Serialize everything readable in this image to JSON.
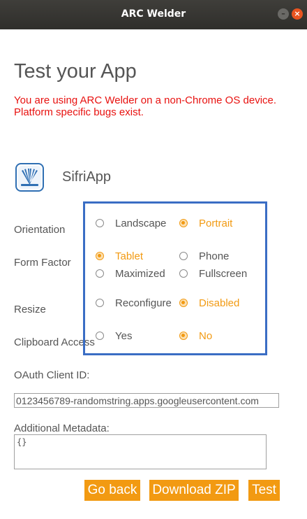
{
  "window": {
    "title": "ARC Welder",
    "minimize_glyph": "–",
    "close_glyph": "×"
  },
  "page": {
    "title": "Test your App",
    "warning": "You are using ARC Welder on a non-Chrome OS device. Platform specific bugs exist."
  },
  "app": {
    "name": "SifriApp",
    "icon": "books-icon"
  },
  "labels": {
    "orientation": "Orientation",
    "form_factor": "Form Factor",
    "resize": "Resize",
    "clipboard_access": "Clipboard Access",
    "oauth_client_id": "OAuth Client ID:",
    "additional_metadata": "Additional Metadata:"
  },
  "options": {
    "orientation": [
      {
        "label": "Landscape",
        "selected": false
      },
      {
        "label": "Portrait",
        "selected": true
      }
    ],
    "form_factor": [
      {
        "label": "Tablet",
        "selected": true
      },
      {
        "label": "Phone",
        "selected": false
      },
      {
        "label": "Maximized",
        "selected": false
      },
      {
        "label": "Fullscreen",
        "selected": false
      }
    ],
    "resize": [
      {
        "label": "Reconfigure",
        "selected": false
      },
      {
        "label": "Disabled",
        "selected": true
      }
    ],
    "clipboard_access": [
      {
        "label": "Yes",
        "selected": false
      },
      {
        "label": "No",
        "selected": true
      }
    ]
  },
  "inputs": {
    "oauth_client_id_value": "0123456789-randomstring.apps.googleusercontent.com",
    "additional_metadata_value": "{}"
  },
  "buttons": {
    "go_back": "Go back",
    "download_zip": "Download ZIP",
    "test": "Test"
  },
  "colors": {
    "accent": "#f29a12",
    "warning": "#e8110f",
    "highlight_box": "#3a6dc4",
    "titlebar": "#2f2e2b"
  }
}
